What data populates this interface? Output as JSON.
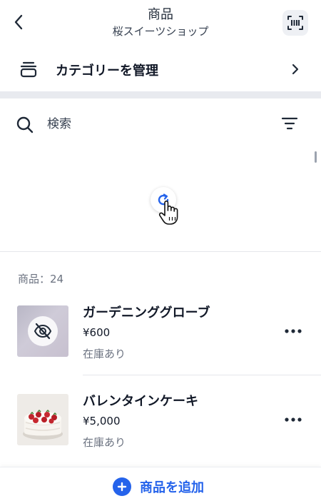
{
  "header": {
    "title": "商品",
    "subtitle": "桜スイーツショップ",
    "back_icon": "chevron-left-icon",
    "scan_icon": "barcode-scan-icon"
  },
  "category": {
    "label": "カテゴリーを管理",
    "icon": "stack-icon"
  },
  "search": {
    "placeholder": "検索",
    "value": ""
  },
  "list": {
    "count_label": "商品：24",
    "items": [
      {
        "name": "ガーデニンググローブ",
        "price": "¥600",
        "stock": "在庫あり",
        "hidden": true
      },
      {
        "name": "バレンタインケーキ",
        "price": "¥5,000",
        "stock": "在庫あり",
        "hidden": false
      }
    ]
  },
  "footer": {
    "add_label": "商品を追加"
  },
  "colors": {
    "accent": "#2563eb",
    "divider": "#e8eaef",
    "text_primary": "#111827",
    "text_secondary": "#6b7280"
  }
}
